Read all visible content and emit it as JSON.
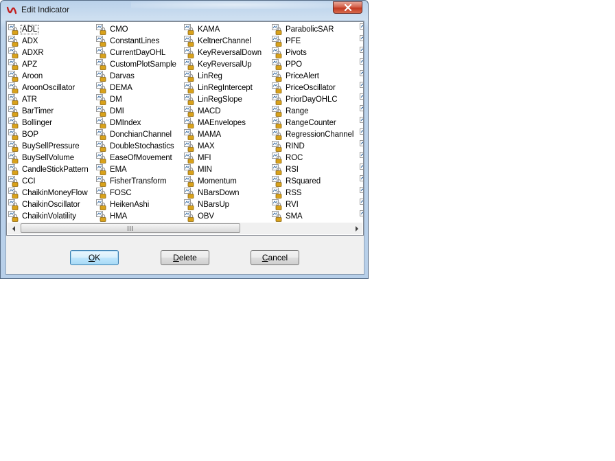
{
  "window": {
    "title": "Edit Indicator"
  },
  "indicators": {
    "columns": [
      [
        "ADL",
        "ADX",
        "ADXR",
        "APZ",
        "Aroon",
        "AroonOscillator",
        "ATR",
        "BarTimer",
        "Bollinger",
        "BOP",
        "BuySellPressure",
        "BuySellVolume",
        "CandleStickPattern",
        "CCI",
        "ChaikinMoneyFlow",
        "ChaikinOscillator",
        "ChaikinVolatility"
      ],
      [
        "CMO",
        "ConstantLines",
        "CurrentDayOHL",
        "CustomPlotSample",
        "Darvas",
        "DEMA",
        "DM",
        "DMI",
        "DMIndex",
        "DonchianChannel",
        "DoubleStochastics",
        "EaseOfMovement",
        "EMA",
        "FisherTransform",
        "FOSC",
        "HeikenAshi",
        "HMA"
      ],
      [
        "KAMA",
        "KeltnerChannel",
        "KeyReversalDown",
        "KeyReversalUp",
        "LinReg",
        "LinRegIntercept",
        "LinRegSlope",
        "MACD",
        "MAEnvelopes",
        "MAMA",
        "MAX",
        "MFI",
        "MIN",
        "Momentum",
        "NBarsDown",
        "NBarsUp",
        "OBV"
      ],
      [
        "ParabolicSAR",
        "PFE",
        "Pivots",
        "PPO",
        "PriceAlert",
        "PriceOscillator",
        "PriorDayOHLC",
        "Range",
        "RangeCounter",
        "RegressionChannel",
        "RIND",
        "ROC",
        "RSI",
        "RSquared",
        "RSS",
        "RVI",
        "SMA"
      ]
    ],
    "selected": "ADL"
  },
  "buttons": {
    "ok_prefix": "",
    "ok_mnemonic": "O",
    "ok_rest": "K",
    "delete_mnemonic": "D",
    "delete_rest": "elete",
    "cancel_mnemonic": "C",
    "cancel_rest": "ancel"
  },
  "colors": {
    "lock_body": "#d9a21b",
    "lock_shackle": "#9a9a9a",
    "selection_outline": "#333333"
  },
  "icons": {
    "item_icon": "locked-indicator-icon",
    "app_icon": "ninjatrader-logo-icon",
    "close": "close-icon"
  }
}
